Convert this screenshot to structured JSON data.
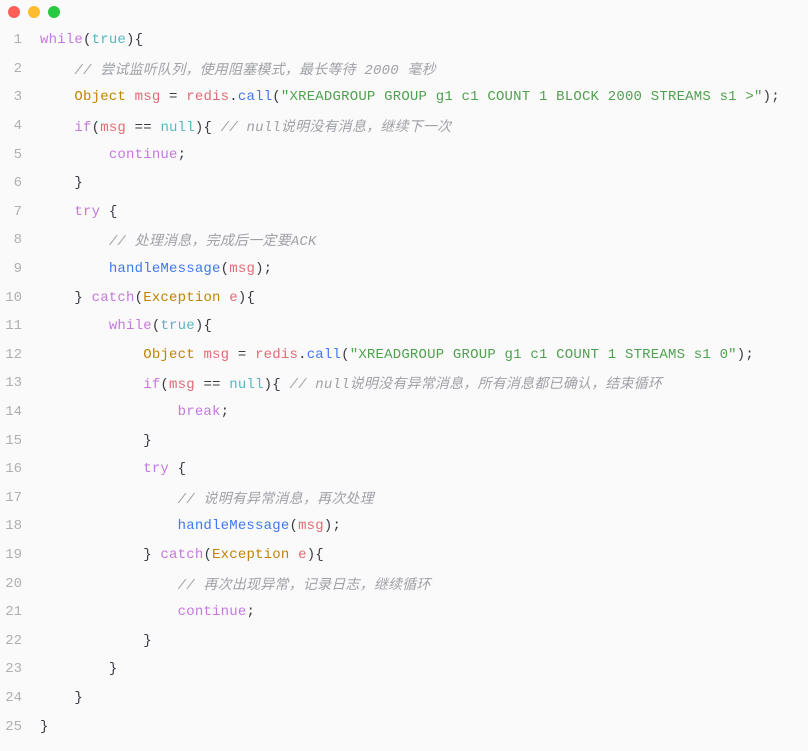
{
  "window": {
    "dots": {
      "red": "#ff5f57",
      "yellow": "#febc2e",
      "green": "#28c840"
    }
  },
  "code": {
    "lines": [
      {
        "n": "1",
        "indent": 0,
        "tokens": [
          {
            "t": "keyword",
            "v": "while"
          },
          {
            "t": "punct",
            "v": "("
          },
          {
            "t": "literal",
            "v": "true"
          },
          {
            "t": "punct",
            "v": "){"
          }
        ]
      },
      {
        "n": "2",
        "indent": 1,
        "tokens": [
          {
            "t": "comment",
            "v": "// 尝试监听队列，使用阻塞模式，最长等待 2000 毫秒"
          }
        ]
      },
      {
        "n": "3",
        "indent": 1,
        "tokens": [
          {
            "t": "type",
            "v": "Object"
          },
          {
            "t": "plain",
            "v": " "
          },
          {
            "t": "ident",
            "v": "msg"
          },
          {
            "t": "plain",
            "v": " "
          },
          {
            "t": "punct",
            "v": "="
          },
          {
            "t": "plain",
            "v": " "
          },
          {
            "t": "ident",
            "v": "redis"
          },
          {
            "t": "punct",
            "v": "."
          },
          {
            "t": "func",
            "v": "call"
          },
          {
            "t": "punct",
            "v": "("
          },
          {
            "t": "string",
            "v": "\"XREADGROUP GROUP g1 c1 COUNT 1 BLOCK 2000 STREAMS s1 >\""
          },
          {
            "t": "punct",
            "v": ");"
          }
        ]
      },
      {
        "n": "4",
        "indent": 1,
        "tokens": [
          {
            "t": "keyword",
            "v": "if"
          },
          {
            "t": "punct",
            "v": "("
          },
          {
            "t": "ident",
            "v": "msg"
          },
          {
            "t": "plain",
            "v": " "
          },
          {
            "t": "punct",
            "v": "=="
          },
          {
            "t": "plain",
            "v": " "
          },
          {
            "t": "literal",
            "v": "null"
          },
          {
            "t": "punct",
            "v": "){ "
          },
          {
            "t": "comment",
            "v": "// null说明没有消息，继续下一次"
          }
        ]
      },
      {
        "n": "5",
        "indent": 2,
        "tokens": [
          {
            "t": "keyword",
            "v": "continue"
          },
          {
            "t": "punct",
            "v": ";"
          }
        ]
      },
      {
        "n": "6",
        "indent": 1,
        "tokens": [
          {
            "t": "punct",
            "v": "}"
          }
        ]
      },
      {
        "n": "7",
        "indent": 1,
        "tokens": [
          {
            "t": "keyword",
            "v": "try"
          },
          {
            "t": "plain",
            "v": " "
          },
          {
            "t": "punct",
            "v": "{"
          }
        ]
      },
      {
        "n": "8",
        "indent": 2,
        "tokens": [
          {
            "t": "comment",
            "v": "// 处理消息，完成后一定要ACK"
          }
        ]
      },
      {
        "n": "9",
        "indent": 2,
        "tokens": [
          {
            "t": "func",
            "v": "handleMessage"
          },
          {
            "t": "punct",
            "v": "("
          },
          {
            "t": "ident",
            "v": "msg"
          },
          {
            "t": "punct",
            "v": ");"
          }
        ]
      },
      {
        "n": "10",
        "indent": 1,
        "tokens": [
          {
            "t": "punct",
            "v": "} "
          },
          {
            "t": "keyword",
            "v": "catch"
          },
          {
            "t": "punct",
            "v": "("
          },
          {
            "t": "type",
            "v": "Exception"
          },
          {
            "t": "plain",
            "v": " "
          },
          {
            "t": "ident",
            "v": "e"
          },
          {
            "t": "punct",
            "v": "){"
          }
        ]
      },
      {
        "n": "11",
        "indent": 2,
        "tokens": [
          {
            "t": "keyword",
            "v": "while"
          },
          {
            "t": "punct",
            "v": "("
          },
          {
            "t": "literal",
            "v": "true"
          },
          {
            "t": "punct",
            "v": "){"
          }
        ]
      },
      {
        "n": "12",
        "indent": 3,
        "tokens": [
          {
            "t": "type",
            "v": "Object"
          },
          {
            "t": "plain",
            "v": " "
          },
          {
            "t": "ident",
            "v": "msg"
          },
          {
            "t": "plain",
            "v": " "
          },
          {
            "t": "punct",
            "v": "="
          },
          {
            "t": "plain",
            "v": " "
          },
          {
            "t": "ident",
            "v": "redis"
          },
          {
            "t": "punct",
            "v": "."
          },
          {
            "t": "func",
            "v": "call"
          },
          {
            "t": "punct",
            "v": "("
          },
          {
            "t": "string",
            "v": "\"XREADGROUP GROUP g1 c1 COUNT 1 STREAMS s1 0\""
          },
          {
            "t": "punct",
            "v": ");"
          }
        ]
      },
      {
        "n": "13",
        "indent": 3,
        "tokens": [
          {
            "t": "keyword",
            "v": "if"
          },
          {
            "t": "punct",
            "v": "("
          },
          {
            "t": "ident",
            "v": "msg"
          },
          {
            "t": "plain",
            "v": " "
          },
          {
            "t": "punct",
            "v": "=="
          },
          {
            "t": "plain",
            "v": " "
          },
          {
            "t": "literal",
            "v": "null"
          },
          {
            "t": "punct",
            "v": "){ "
          },
          {
            "t": "comment",
            "v": "// null说明没有异常消息，所有消息都已确认，结束循环"
          }
        ]
      },
      {
        "n": "14",
        "indent": 4,
        "tokens": [
          {
            "t": "keyword",
            "v": "break"
          },
          {
            "t": "punct",
            "v": ";"
          }
        ]
      },
      {
        "n": "15",
        "indent": 3,
        "tokens": [
          {
            "t": "punct",
            "v": "}"
          }
        ]
      },
      {
        "n": "16",
        "indent": 3,
        "tokens": [
          {
            "t": "keyword",
            "v": "try"
          },
          {
            "t": "plain",
            "v": " "
          },
          {
            "t": "punct",
            "v": "{"
          }
        ]
      },
      {
        "n": "17",
        "indent": 4,
        "tokens": [
          {
            "t": "comment",
            "v": "// 说明有异常消息，再次处理"
          }
        ]
      },
      {
        "n": "18",
        "indent": 4,
        "tokens": [
          {
            "t": "func",
            "v": "handleMessage"
          },
          {
            "t": "punct",
            "v": "("
          },
          {
            "t": "ident",
            "v": "msg"
          },
          {
            "t": "punct",
            "v": ");"
          }
        ]
      },
      {
        "n": "19",
        "indent": 3,
        "tokens": [
          {
            "t": "punct",
            "v": "} "
          },
          {
            "t": "keyword",
            "v": "catch"
          },
          {
            "t": "punct",
            "v": "("
          },
          {
            "t": "type",
            "v": "Exception"
          },
          {
            "t": "plain",
            "v": " "
          },
          {
            "t": "ident",
            "v": "e"
          },
          {
            "t": "punct",
            "v": "){"
          }
        ]
      },
      {
        "n": "20",
        "indent": 4,
        "tokens": [
          {
            "t": "comment",
            "v": "// 再次出现异常，记录日志，继续循环"
          }
        ]
      },
      {
        "n": "21",
        "indent": 4,
        "tokens": [
          {
            "t": "keyword",
            "v": "continue"
          },
          {
            "t": "punct",
            "v": ";"
          }
        ]
      },
      {
        "n": "22",
        "indent": 3,
        "tokens": [
          {
            "t": "punct",
            "v": "}"
          }
        ]
      },
      {
        "n": "23",
        "indent": 2,
        "tokens": [
          {
            "t": "punct",
            "v": "}"
          }
        ]
      },
      {
        "n": "24",
        "indent": 1,
        "tokens": [
          {
            "t": "punct",
            "v": "}"
          }
        ]
      },
      {
        "n": "25",
        "indent": 0,
        "tokens": [
          {
            "t": "punct",
            "v": "}"
          }
        ]
      }
    ]
  }
}
